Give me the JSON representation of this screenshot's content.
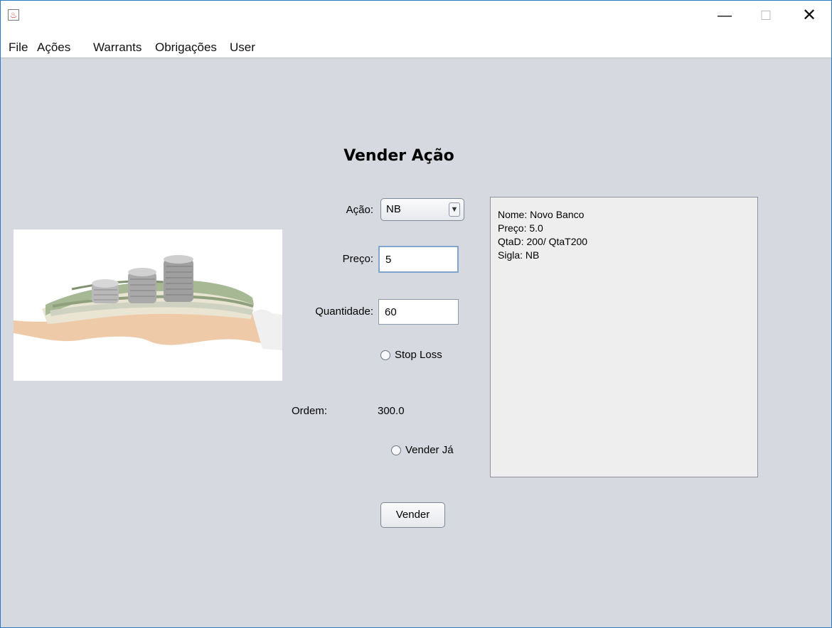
{
  "window": {
    "minimize_glyph": "—",
    "maximize_glyph": "☐",
    "close_glyph": "✕"
  },
  "menu": [
    "File",
    "Ações",
    "Warrants",
    "Obrigações",
    "User"
  ],
  "form": {
    "title": "Vender Ação",
    "acao_label": "Ação:",
    "acao_value": "NB",
    "preco_label": "Preço:",
    "preco_value": "5",
    "quantidade_label": "Quantidade:",
    "quantidade_value": "60",
    "stop_loss_label": "Stop Loss",
    "ordem_label": "Ordem:",
    "ordem_value": "300.0",
    "vender_ja_label": "Vender Já",
    "submit_label": "Vender"
  },
  "info_lines": [
    "Nome: Novo Banco",
    "Preço: 5.0",
    "QtaD: 200/  QtaT200",
    "Sigla: NB"
  ],
  "icons": {
    "app_icon": "java-cup-icon",
    "combo_arrow": "chevron-down-icon"
  },
  "colors": {
    "background": "#d6d9df",
    "window_border": "#2b79c2",
    "focused_field_border": "#7fa4cf"
  }
}
